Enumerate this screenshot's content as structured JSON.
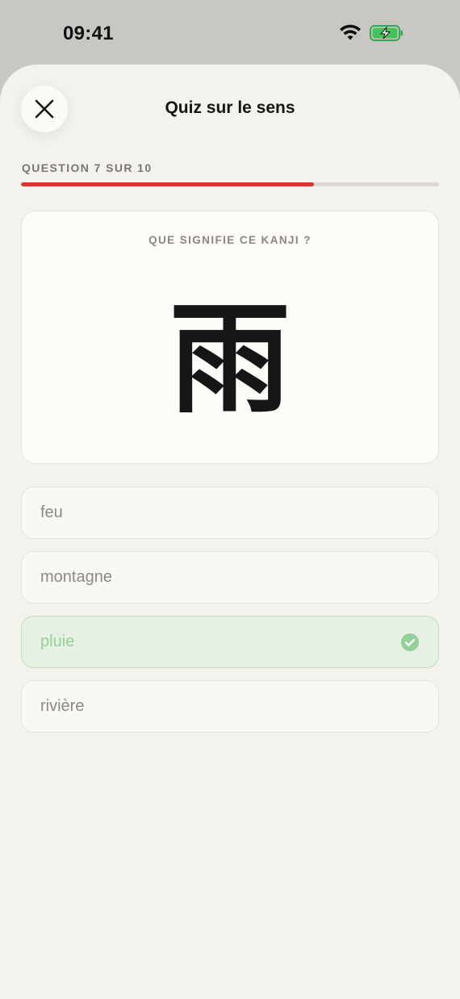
{
  "status": {
    "time": "09:41"
  },
  "header": {
    "title": "Quiz sur le sens"
  },
  "progress": {
    "label": "QUESTION 7 SUR 10",
    "current": 7,
    "total": 10,
    "fraction": 0.7
  },
  "card": {
    "prompt": "QUE SIGNIFIE CE KANJI ?",
    "kanji": "雨"
  },
  "answers": [
    {
      "label": "feu",
      "state": "dimmed"
    },
    {
      "label": "montagne",
      "state": "dimmed"
    },
    {
      "label": "pluie",
      "state": "correct"
    },
    {
      "label": "rivière",
      "state": "dimmed"
    }
  ],
  "colors": {
    "accent": "#cc3b2e",
    "correct": "#93d199",
    "background": "#f4f2ed"
  },
  "icons": [
    "wifi-icon",
    "battery-charging-icon",
    "close-icon",
    "check-circle-icon"
  ]
}
